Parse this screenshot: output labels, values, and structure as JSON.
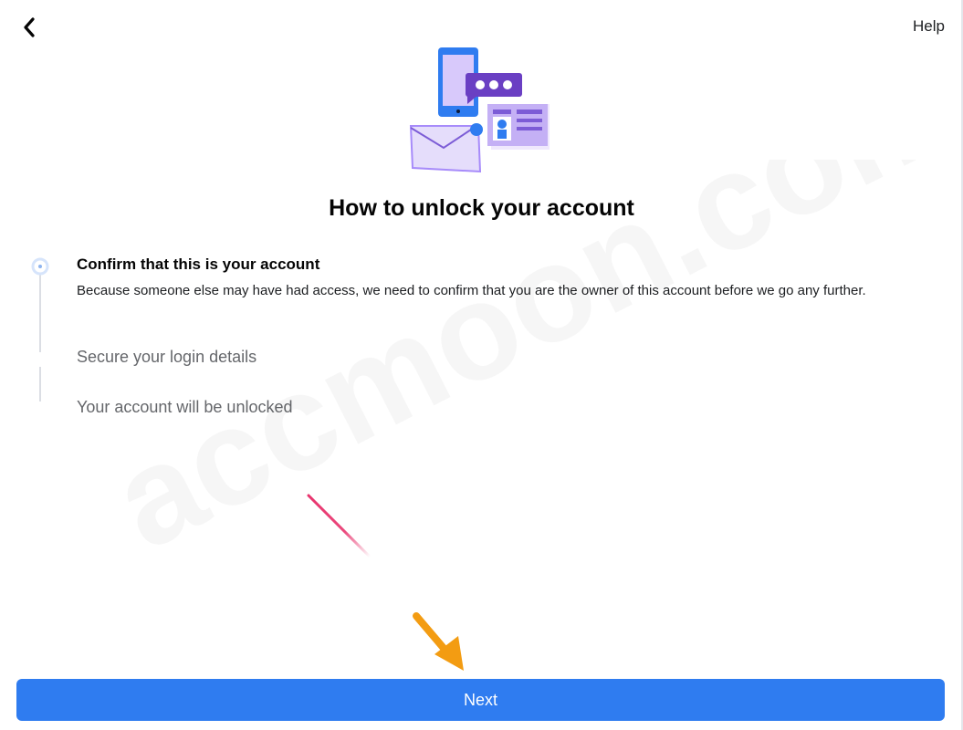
{
  "header": {
    "back_icon": "chevron-left-icon",
    "help_label": "Help"
  },
  "illustration": {
    "icon": "account-verification-illustration"
  },
  "page_title": "How to unlock your account",
  "steps": [
    {
      "title": "Confirm that this is your account",
      "description": "Because someone else may have had access, we need to confirm that you are the owner of this account before we go any further.",
      "state": "active"
    },
    {
      "title": "Secure your login details",
      "state": "pending"
    },
    {
      "title": "Your account will be unlocked",
      "state": "pending"
    }
  ],
  "watermark": "accmoon.com",
  "next_button": {
    "label": "Next"
  },
  "colors": {
    "primary_button": "#2f7cf0",
    "title_text": "#050505",
    "muted_text": "#65676b",
    "illustration_purple": "#a78bfa",
    "illustration_blue": "#3b82f6",
    "annotation_arrow": "#f39c12",
    "annotation_line": "#e8336d"
  }
}
